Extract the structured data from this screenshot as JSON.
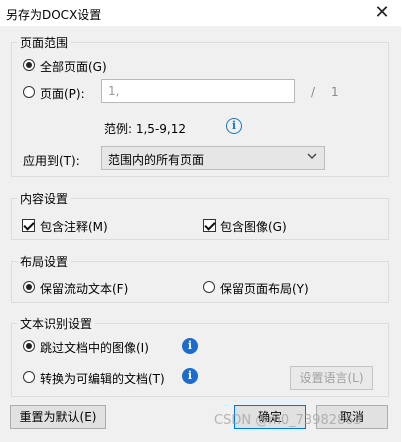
{
  "window": {
    "title": "另存为DOCX设置",
    "close_glyph": "✕"
  },
  "page_range": {
    "legend": "页面范围",
    "all_pages_label": "全部页面(G)",
    "pages_label": "页面(P):",
    "pages_value": "1,",
    "page_separator": "/",
    "page_total": "1",
    "example_label": "范例: 1,5-9,12",
    "apply_to_label": "应用到(T):",
    "apply_to_value": "范围内的所有页面"
  },
  "content_settings": {
    "legend": "内容设置",
    "include_comments_label": "包含注释(M)",
    "include_images_label": "包含图像(G)"
  },
  "layout_settings": {
    "legend": "布局设置",
    "flowing_text_label": "保留流动文本(F)",
    "page_layout_label": "保留页面布局(Y)"
  },
  "ocr_settings": {
    "legend": "文本识别设置",
    "skip_images_label": "跳过文档中的图像(I)",
    "convert_editable_label": "转换为可编辑的文档(T)",
    "language_button": "设置语言(L)"
  },
  "footer": {
    "reset_button": "重置为默认(E)",
    "ok_button": "确定",
    "cancel_button": "取消"
  },
  "watermark": {
    "text": "CSDN @m0_73982863"
  },
  "icons": {
    "info": "info-icon",
    "info_glyph": "i",
    "chevron": "chevron-down-icon",
    "close": "close-icon"
  }
}
